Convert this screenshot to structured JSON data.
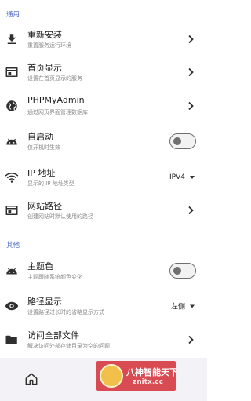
{
  "sections": [
    {
      "header": "通用",
      "items": [
        {
          "title": "重新安装",
          "subtitle": "重置服务运行环境",
          "control": "chevron",
          "icon": "download-icon"
        },
        {
          "title": "首页显示",
          "subtitle": "设置在首页显示的服务",
          "control": "chevron",
          "icon": "window-icon"
        },
        {
          "title": "PHPMyAdmin",
          "subtitle": "通过网页界面管理数据库",
          "control": "chevron",
          "icon": "globe-icon"
        },
        {
          "title": "自启动",
          "subtitle": "仅开机时生效",
          "control": "toggle",
          "checked": false,
          "icon": "android-icon"
        },
        {
          "title": "IP 地址",
          "subtitle": "显示的 IP 地址类型",
          "control": "select",
          "value": "IPV4",
          "icon": "wifi-icon"
        },
        {
          "title": "网站路径",
          "subtitle": "创建网站时默认使用的路径",
          "control": "chevron",
          "icon": "window-icon"
        }
      ]
    },
    {
      "header": "其他",
      "items": [
        {
          "title": "主题色",
          "subtitle": "主题跟随系统颜色变化",
          "control": "toggle",
          "checked": false,
          "icon": "android-icon"
        },
        {
          "title": "路径显示",
          "subtitle": "设置路径过长时的省略显示方式",
          "control": "select",
          "value": "左侧",
          "icon": "eye-icon"
        },
        {
          "title": "访问全部文件",
          "subtitle": "解决访问外部存储目录为空的问题",
          "control": "chevron",
          "icon": "folder-icon"
        }
      ]
    }
  ],
  "bottom_nav": {
    "home_icon": "home-icon"
  },
  "watermark": {
    "line1": "八神智能天下",
    "line2": "znitx.cc"
  },
  "colors": {
    "accent": "#4a66c4",
    "icon": "#2f2f2f",
    "subtitle": "#8b8b8b",
    "bottom_bar": "#f3f2f6",
    "watermark_bg": "#d94b52"
  }
}
